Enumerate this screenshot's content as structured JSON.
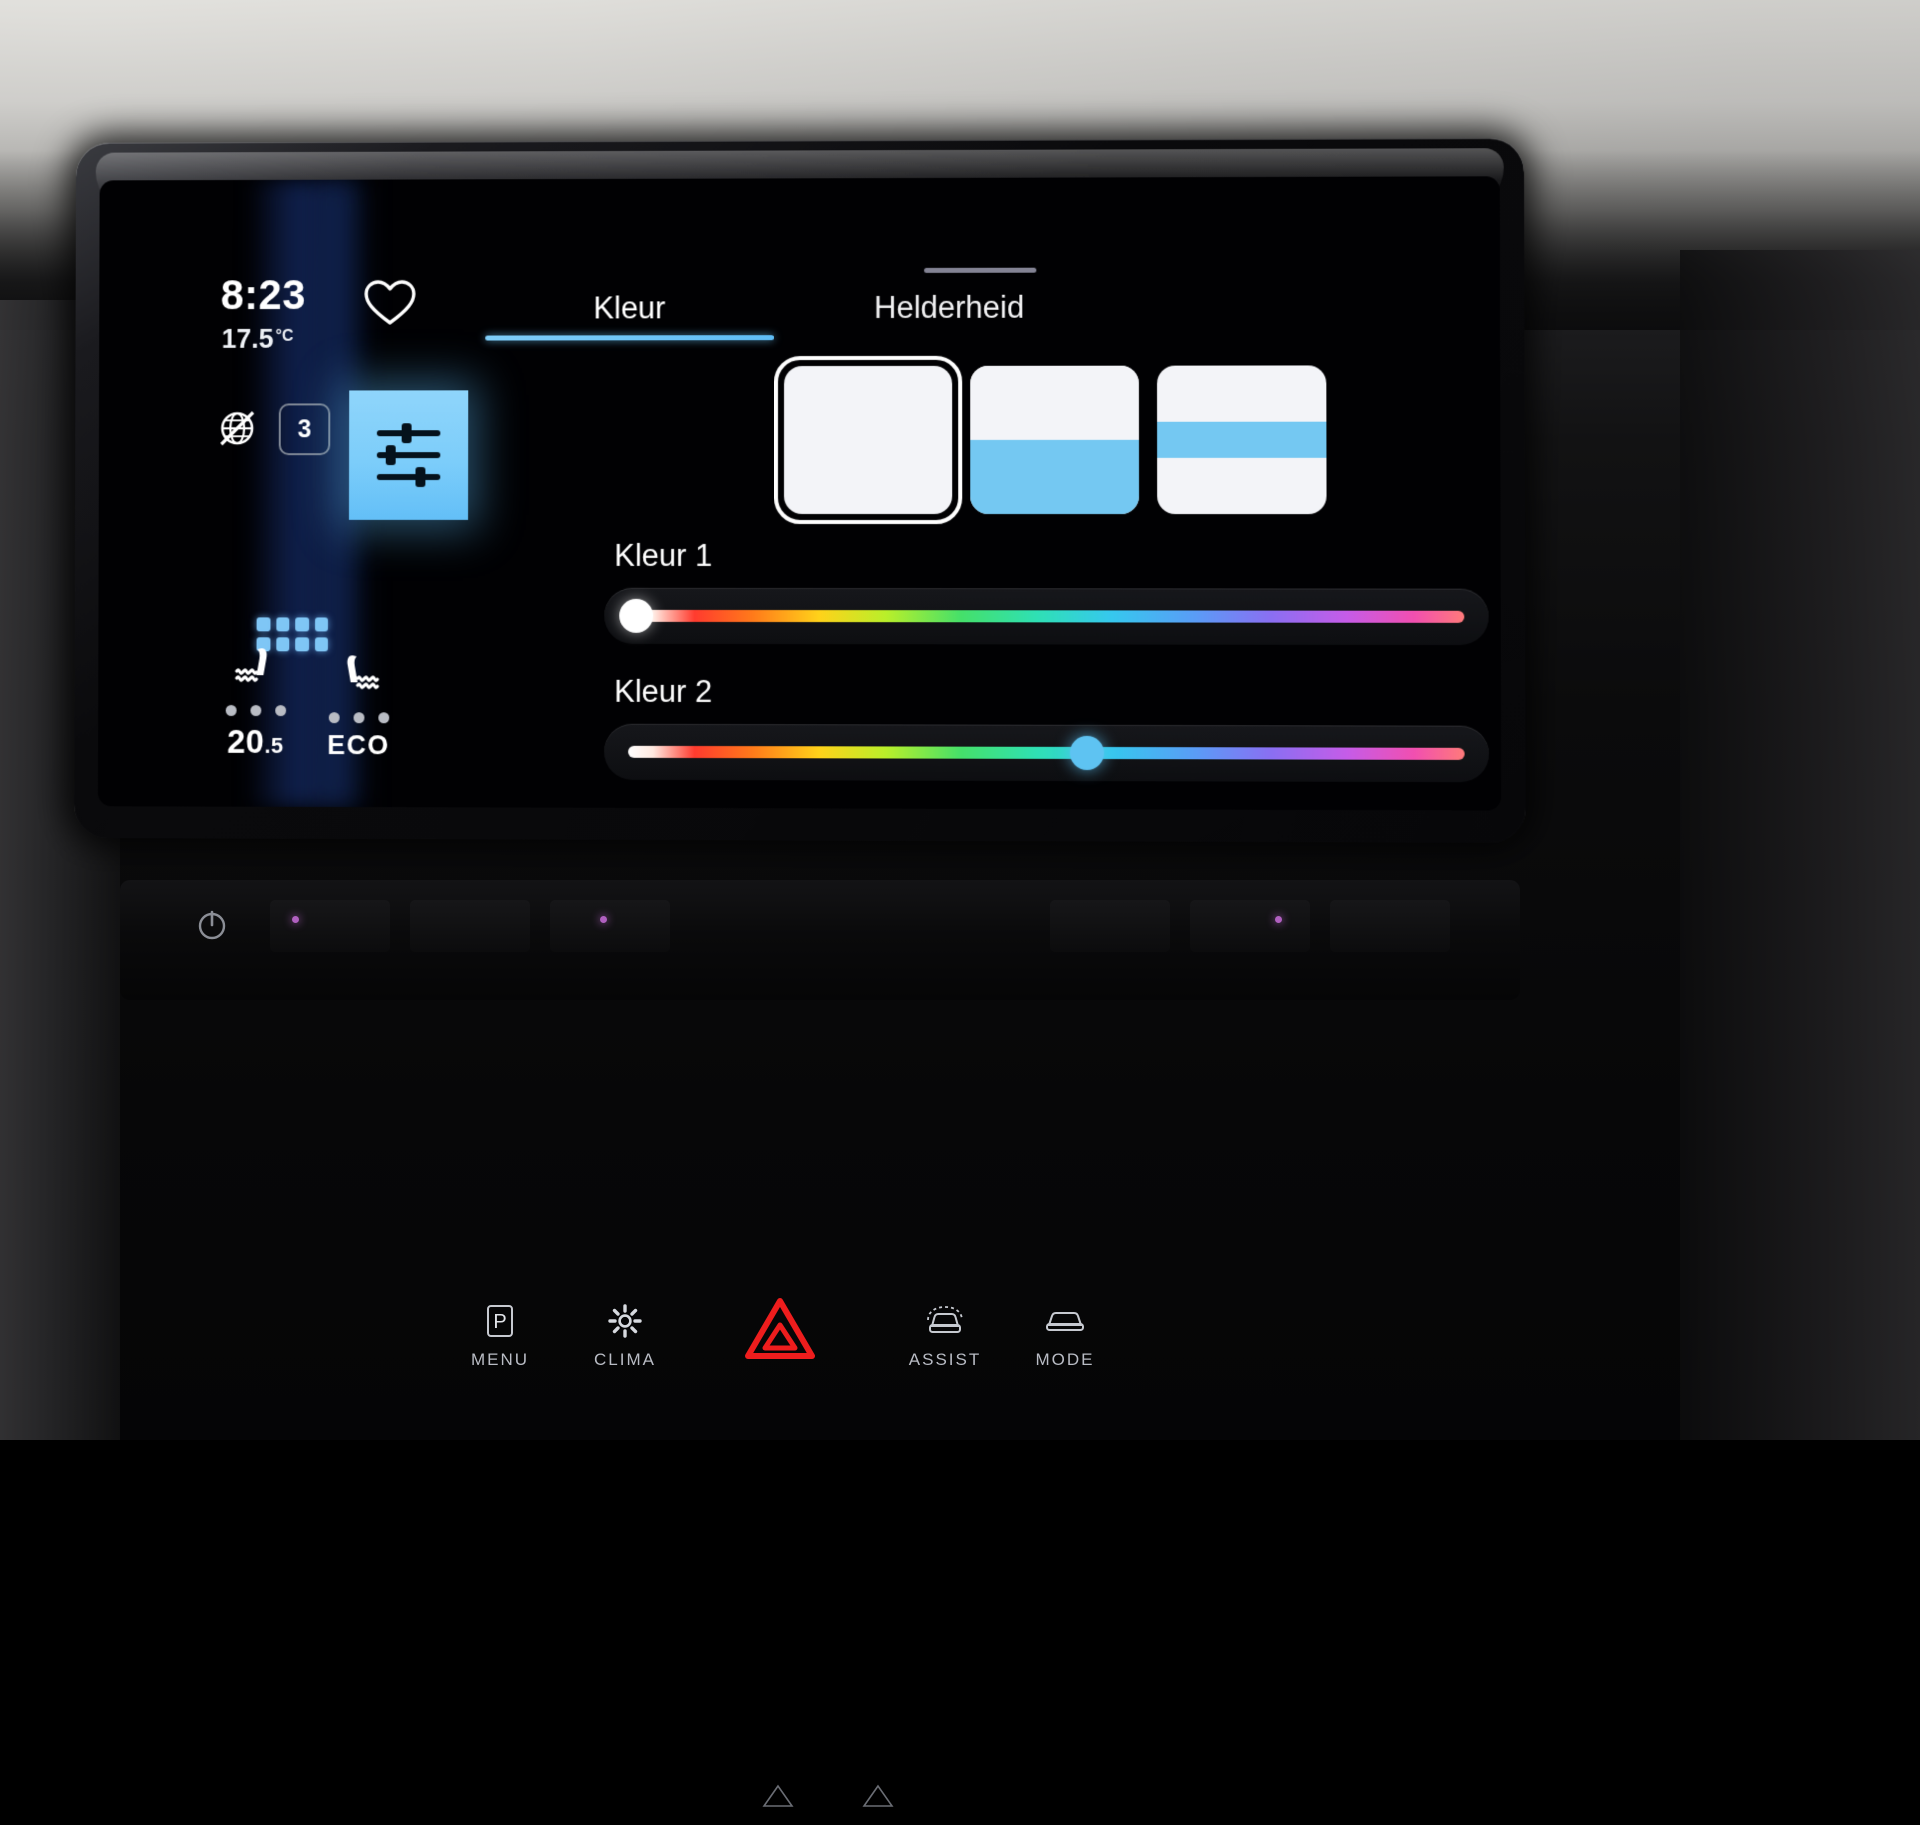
{
  "status_rail": {
    "clock": "8:23",
    "outside_temp": "17.5",
    "temp_unit": "°C",
    "heart_icon": "heart-icon",
    "no_network_icon": "air-recirculation-off-icon",
    "fan_speed_badge": "3",
    "equalizer_icon": "sliders-icon",
    "app_grid_icon": "app-grid-icon",
    "seats": [
      {
        "icon": "seat-heating-icon",
        "dots": 3,
        "value": "20",
        "fraction": ".5"
      },
      {
        "icon": "seat-heating-icon",
        "dots": 3,
        "value": "ECO",
        "fraction": ""
      }
    ]
  },
  "main": {
    "drag_handle": "drag-handle",
    "tabs": [
      {
        "label": "Kleur",
        "active": true
      },
      {
        "label": "Helderheid",
        "active": false
      }
    ],
    "presets": [
      {
        "name": "preset-solid-white",
        "style": "solid",
        "selected": true
      },
      {
        "name": "preset-split-half",
        "style": "half",
        "selected": false
      },
      {
        "name": "preset-center-stripe",
        "style": "stripe",
        "selected": false
      }
    ],
    "sliders": [
      {
        "label": "Kleur 1",
        "value_pct": 1,
        "thumb_color": "#ffffff"
      },
      {
        "label": "Kleur 2",
        "value_pct": 55,
        "thumb_color": "#5ec3f2"
      }
    ]
  },
  "hardware_bar": {
    "buttons": [
      {
        "label": "MENU",
        "icon": "parking-p-icon"
      },
      {
        "label": "CLIMA",
        "icon": "fan-icon"
      },
      {
        "label": "",
        "icon": "hazard-triangle-icon"
      },
      {
        "label": "ASSIST",
        "icon": "car-assist-icon"
      },
      {
        "label": "MODE",
        "icon": "car-mode-icon"
      }
    ],
    "power_icon": "power-icon"
  },
  "colors": {
    "accent_blue": "#74c8f2",
    "tile_blue": "#7ccdfa",
    "hazard_red": "#e01b1b",
    "text_primary": "#ffffff",
    "text_secondary": "#b9bcc4"
  }
}
